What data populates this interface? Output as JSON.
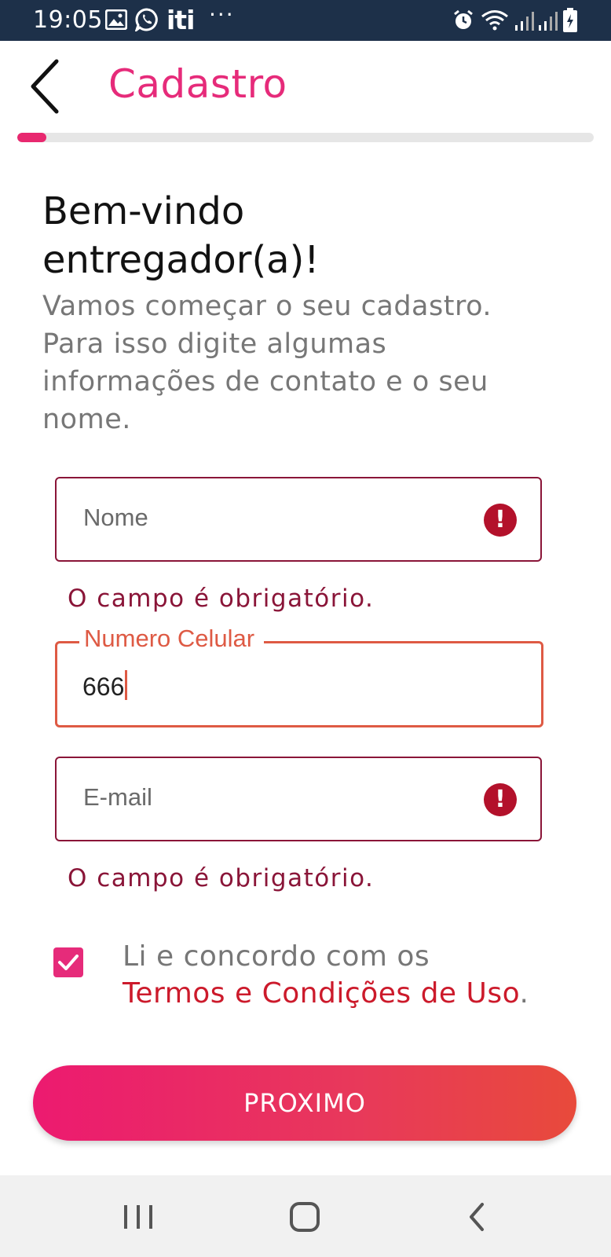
{
  "status_bar": {
    "time": "19:05",
    "left_icons": [
      "gallery-icon",
      "whatsapp-icon",
      "iti-app-icon",
      "more-notifications-icon"
    ],
    "iti_label": "iti",
    "more_label": "···",
    "right_icons": [
      "alarm-icon",
      "wifi-icon",
      "signal-icon",
      "signal-icon",
      "battery-charging-icon"
    ]
  },
  "header": {
    "title": "Cadastro",
    "back_icon": "chevron-left-icon"
  },
  "progress": {
    "value": 0.05,
    "accent": "#e8286f"
  },
  "welcome": {
    "heading_line1": "Bem-vindo",
    "heading_line2": "entregador(a)!",
    "intro_line1": "Vamos começar o seu cadastro.",
    "intro_line2": "Para isso digite algumas",
    "intro_line3": "informações de contato e o seu",
    "intro_line4": "nome."
  },
  "form": {
    "name": {
      "placeholder": "Nome",
      "error": "O campo é obrigatório.",
      "error_icon": "alert-circle-icon"
    },
    "phone": {
      "label": "Numero Celular",
      "value": "666"
    },
    "email": {
      "placeholder": "E-mail",
      "error": "O campo é obrigatório.",
      "error_icon": "alert-circle-icon"
    }
  },
  "terms": {
    "checked": true,
    "line1": "Li e concordo com os",
    "link": "Termos e Condições de Uso",
    "suffix": "."
  },
  "next_button": {
    "label": "PROXIMO"
  },
  "nav_bar": {
    "recent_icon": "recent-apps-icon",
    "home_icon": "home-icon",
    "back_icon": "back-icon"
  },
  "colors": {
    "brand_pink": "#e62b7a",
    "error_red": "#8a1538",
    "focus_orange": "#de5a44",
    "status_bar_bg": "#1d3049"
  }
}
